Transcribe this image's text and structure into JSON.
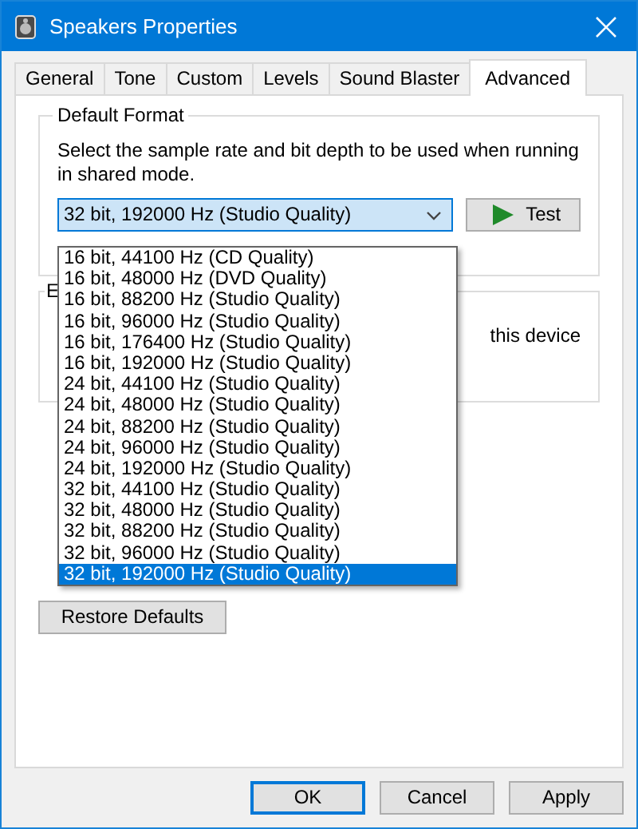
{
  "window": {
    "title": "Speakers Properties"
  },
  "tabs": [
    {
      "label": "General",
      "selected": false
    },
    {
      "label": "Tone",
      "selected": false
    },
    {
      "label": "Custom",
      "selected": false
    },
    {
      "label": "Levels",
      "selected": false
    },
    {
      "label": "Sound Blaster",
      "selected": false
    },
    {
      "label": "Advanced",
      "selected": true
    }
  ],
  "default_format": {
    "title": "Default Format",
    "description": "Select the sample rate and bit depth to be used when running in shared mode.",
    "combo": {
      "value": "32 bit, 192000 Hz (Studio Quality)",
      "expanded": true
    },
    "test_button": {
      "label": "Test"
    },
    "options": [
      {
        "label": "16 bit, 44100 Hz (CD Quality)",
        "selected": false
      },
      {
        "label": "16 bit, 48000 Hz (DVD Quality)",
        "selected": false
      },
      {
        "label": "16 bit, 88200 Hz (Studio Quality)",
        "selected": false
      },
      {
        "label": "16 bit, 96000 Hz (Studio Quality)",
        "selected": false
      },
      {
        "label": "16 bit, 176400 Hz (Studio Quality)",
        "selected": false
      },
      {
        "label": "16 bit, 192000 Hz (Studio Quality)",
        "selected": false
      },
      {
        "label": "24 bit, 44100 Hz (Studio Quality)",
        "selected": false
      },
      {
        "label": "24 bit, 48000 Hz (Studio Quality)",
        "selected": false
      },
      {
        "label": "24 bit, 88200 Hz (Studio Quality)",
        "selected": false
      },
      {
        "label": "24 bit, 96000 Hz (Studio Quality)",
        "selected": false
      },
      {
        "label": "24 bit, 192000 Hz (Studio Quality)",
        "selected": false
      },
      {
        "label": "32 bit, 44100 Hz (Studio Quality)",
        "selected": false
      },
      {
        "label": "32 bit, 48000 Hz (Studio Quality)",
        "selected": false
      },
      {
        "label": "32 bit, 88200 Hz (Studio Quality)",
        "selected": false
      },
      {
        "label": "32 bit, 96000 Hz (Studio Quality)",
        "selected": false
      },
      {
        "label": "32 bit, 192000 Hz (Studio Quality)",
        "selected": true
      }
    ]
  },
  "group_2": {
    "title": "E",
    "text": "this device"
  },
  "restore_button": {
    "label": "Restore Defaults"
  },
  "buttons": [
    {
      "label": "OK",
      "default": true
    },
    {
      "label": "Cancel",
      "default": false
    },
    {
      "label": "Apply",
      "default": false
    }
  ]
}
